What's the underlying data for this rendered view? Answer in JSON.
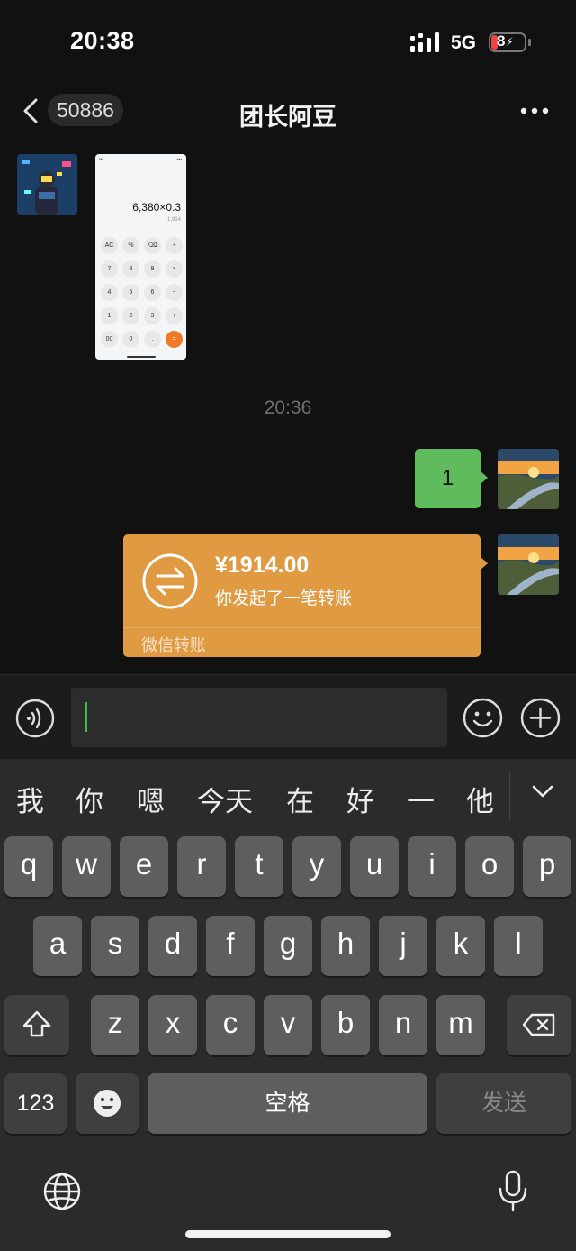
{
  "status_bar": {
    "time": "20:38",
    "network": "5G",
    "battery": "8"
  },
  "nav": {
    "back_count": "50886",
    "title": "团长阿豆"
  },
  "messages": {
    "calculator": {
      "expression": "6,380×0.3",
      "result": "1,914",
      "keys": [
        "AC",
        "%",
        "⌫",
        "÷",
        "7",
        "8",
        "9",
        "×",
        "4",
        "5",
        "6",
        "−",
        "1",
        "2",
        "3",
        "+",
        "00",
        "0",
        ".",
        "="
      ]
    },
    "timestamp": "20:36",
    "sent_text": "1",
    "transfer": {
      "amount": "¥1914.00",
      "description": "你发起了一笔转账",
      "label": "微信转账"
    }
  },
  "keyboard": {
    "candidates": [
      "我",
      "你",
      "嗯",
      "今天",
      "在",
      "好",
      "一",
      "他"
    ],
    "row1": [
      "q",
      "w",
      "e",
      "r",
      "t",
      "y",
      "u",
      "i",
      "o",
      "p"
    ],
    "row2": [
      "a",
      "s",
      "d",
      "f",
      "g",
      "h",
      "j",
      "k",
      "l"
    ],
    "row3": [
      "z",
      "x",
      "c",
      "v",
      "b",
      "n",
      "m"
    ],
    "num_key": "123",
    "space_key": "空格",
    "send_key": "发送"
  },
  "icons": {
    "back": "chevron-left",
    "more": "ellipsis",
    "voice": "voice-waves",
    "emoji": "smiley-face",
    "plus": "plus-circle",
    "shift": "shift-arrow",
    "delete": "backspace",
    "emoji_key": "smiley-filled",
    "globe": "globe",
    "mic": "microphone",
    "collapse": "chevron-down"
  },
  "colors": {
    "sent_bubble": "#5fbb5b",
    "transfer_card": "#e09a42",
    "cursor": "#3ebc48"
  }
}
